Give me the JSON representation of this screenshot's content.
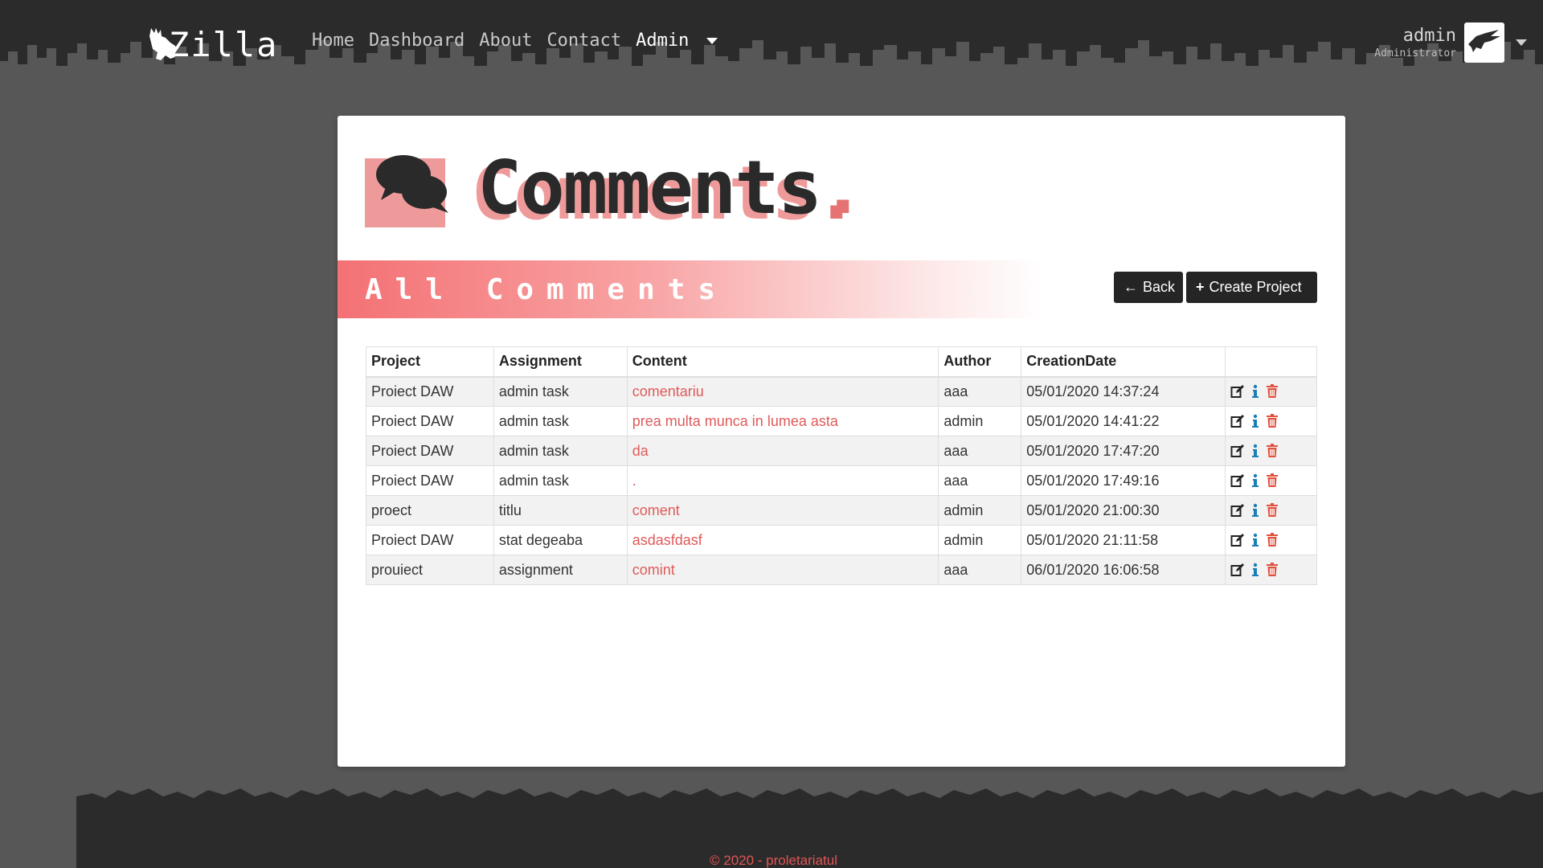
{
  "navbar": {
    "brand": "Zilla",
    "links": [
      {
        "label": "Home",
        "active": false
      },
      {
        "label": "Dashboard",
        "active": false
      },
      {
        "label": "About",
        "active": false
      },
      {
        "label": "Contact",
        "active": false
      },
      {
        "label": "Admin",
        "active": true
      }
    ],
    "user": {
      "name": "admin",
      "role": "Administrator"
    }
  },
  "page": {
    "title": "Comments",
    "title_dot": ".",
    "section_title": "All Comments",
    "back_label": "Back",
    "create_label": "Create Project"
  },
  "table": {
    "headers": [
      "Project",
      "Assignment",
      "Content",
      "Author",
      "CreationDate",
      ""
    ],
    "rows": [
      {
        "project": "Proiect DAW",
        "assignment": "admin task",
        "content": "comentariu",
        "author": "aaa",
        "date": "05/01/2020 14:37:24"
      },
      {
        "project": "Proiect DAW",
        "assignment": "admin task",
        "content": "prea multa munca in lumea asta",
        "author": "admin",
        "date": "05/01/2020 14:41:22"
      },
      {
        "project": "Proiect DAW",
        "assignment": "admin task",
        "content": "da",
        "author": "aaa",
        "date": "05/01/2020 17:47:20"
      },
      {
        "project": "Proiect DAW",
        "assignment": "admin task",
        "content": ".",
        "author": "aaa",
        "date": "05/01/2020 17:49:16"
      },
      {
        "project": "proect",
        "assignment": "titlu",
        "content": "coment",
        "author": "admin",
        "date": "05/01/2020 21:00:30"
      },
      {
        "project": "Proiect DAW",
        "assignment": "stat degeaba",
        "content": "asdasfdasf",
        "author": "admin",
        "date": "05/01/2020 21:11:58"
      },
      {
        "project": "prouiect",
        "assignment": "assignment",
        "content": "comint",
        "author": "aaa",
        "date": "06/01/2020 16:06:58"
      }
    ]
  },
  "footer": {
    "text": "© 2020 - proletariatul"
  },
  "colors": {
    "accent": "#e05a5a",
    "pink": "#ef9a9a",
    "dark": "#2b2b2b",
    "info": "#1a7fb8",
    "danger": "#e0503c"
  },
  "icons": {
    "edit": "edit-icon",
    "info": "info-icon",
    "delete": "trash-icon",
    "back": "arrow-left-icon",
    "create": "plus-icon",
    "header": "comments-icon"
  }
}
